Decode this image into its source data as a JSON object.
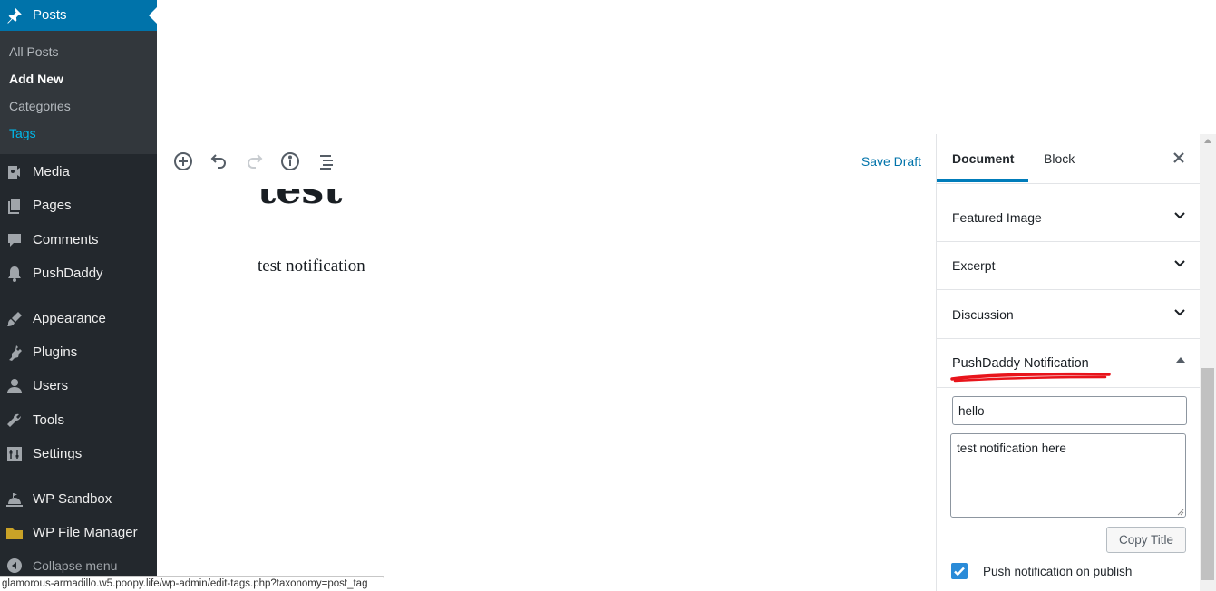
{
  "sidebar": {
    "posts": {
      "label": "Posts",
      "icon": "pin-icon"
    },
    "submenu": [
      {
        "label": "All Posts"
      },
      {
        "label": "Add New"
      },
      {
        "label": "Categories"
      },
      {
        "label": "Tags"
      }
    ],
    "items": [
      {
        "label": "Media",
        "icon": "media-icon"
      },
      {
        "label": "Pages",
        "icon": "pages-icon"
      },
      {
        "label": "Comments",
        "icon": "comments-icon"
      },
      {
        "label": "PushDaddy",
        "icon": "bell-icon"
      },
      {
        "label": "Appearance",
        "icon": "paintbrush-icon"
      },
      {
        "label": "Plugins",
        "icon": "plug-icon"
      },
      {
        "label": "Users",
        "icon": "user-icon"
      },
      {
        "label": "Tools",
        "icon": "wrench-icon"
      },
      {
        "label": "Settings",
        "icon": "settings-icon"
      },
      {
        "label": "WP Sandbox",
        "icon": "sandbox-icon"
      },
      {
        "label": "WP File Manager",
        "icon": "folder-icon"
      },
      {
        "label": "Collapse menu",
        "icon": "collapse-icon"
      }
    ],
    "colors": {
      "bg": "#23282d",
      "active": "#0073aa",
      "submenu_bg": "#32373c",
      "hover_link": "#00b9eb"
    }
  },
  "statusbar": {
    "url": "glamorous-armadillo.w5.poopy.life/wp-admin/edit-tags.php?taxonomy=post_tag"
  },
  "toolbar": {
    "save_draft": "Save Draft",
    "icons": [
      "add-block-icon",
      "undo-icon",
      "redo-icon",
      "info-icon",
      "outline-icon"
    ]
  },
  "editor": {
    "title": "test",
    "paragraph": "test notification"
  },
  "settings": {
    "tabs": [
      {
        "label": "Document"
      },
      {
        "label": "Block"
      }
    ],
    "panels": [
      {
        "label": "Featured Image"
      },
      {
        "label": "Excerpt"
      },
      {
        "label": "Discussion"
      }
    ],
    "pushdaddy": {
      "title": "PushDaddy Notification",
      "title_value": "hello",
      "body_value": "test notification here",
      "copy_button": "Copy Title",
      "checkbox_label": "Push notification on publish",
      "checked": true
    },
    "colors": {
      "accent": "#007cba",
      "checkbox": "#2a8bd8",
      "annotation": "#e8141b"
    }
  }
}
